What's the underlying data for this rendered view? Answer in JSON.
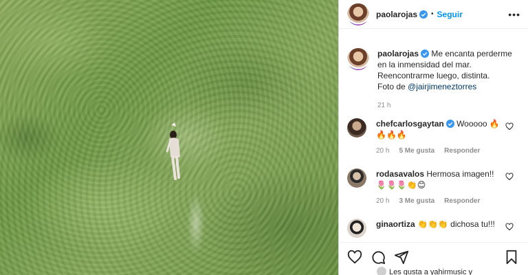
{
  "post": {
    "owner": "paolarojas",
    "follow_label": "Seguir",
    "dot": "•",
    "more": "•••",
    "caption_lines": [
      "Me encanta perderme",
      "en la inmensidad del mar.",
      "Reencontrarme luego, distinta.",
      "Foto de "
    ],
    "caption_mention": "@jairjimeneztorres",
    "caption_time": "21 h"
  },
  "comments": [
    {
      "user": "chefcarlosgaytan",
      "text": "Wooooo 🔥",
      "text2": "🔥🔥🔥",
      "time": "20 h",
      "likes": "5 Me gusta",
      "reply": "Responder"
    },
    {
      "user": "rodasavalos",
      "text": "Hermosa imagen!!",
      "text2": "🌷🌷🌷👏😊",
      "time": "20 h",
      "likes": "3 Me gusta",
      "reply": "Responder"
    },
    {
      "user": "ginaortiza",
      "text": "👏👏👏 dichosa tu!!!"
    }
  ],
  "likes_text": "Les gusta a yahirmusic y"
}
